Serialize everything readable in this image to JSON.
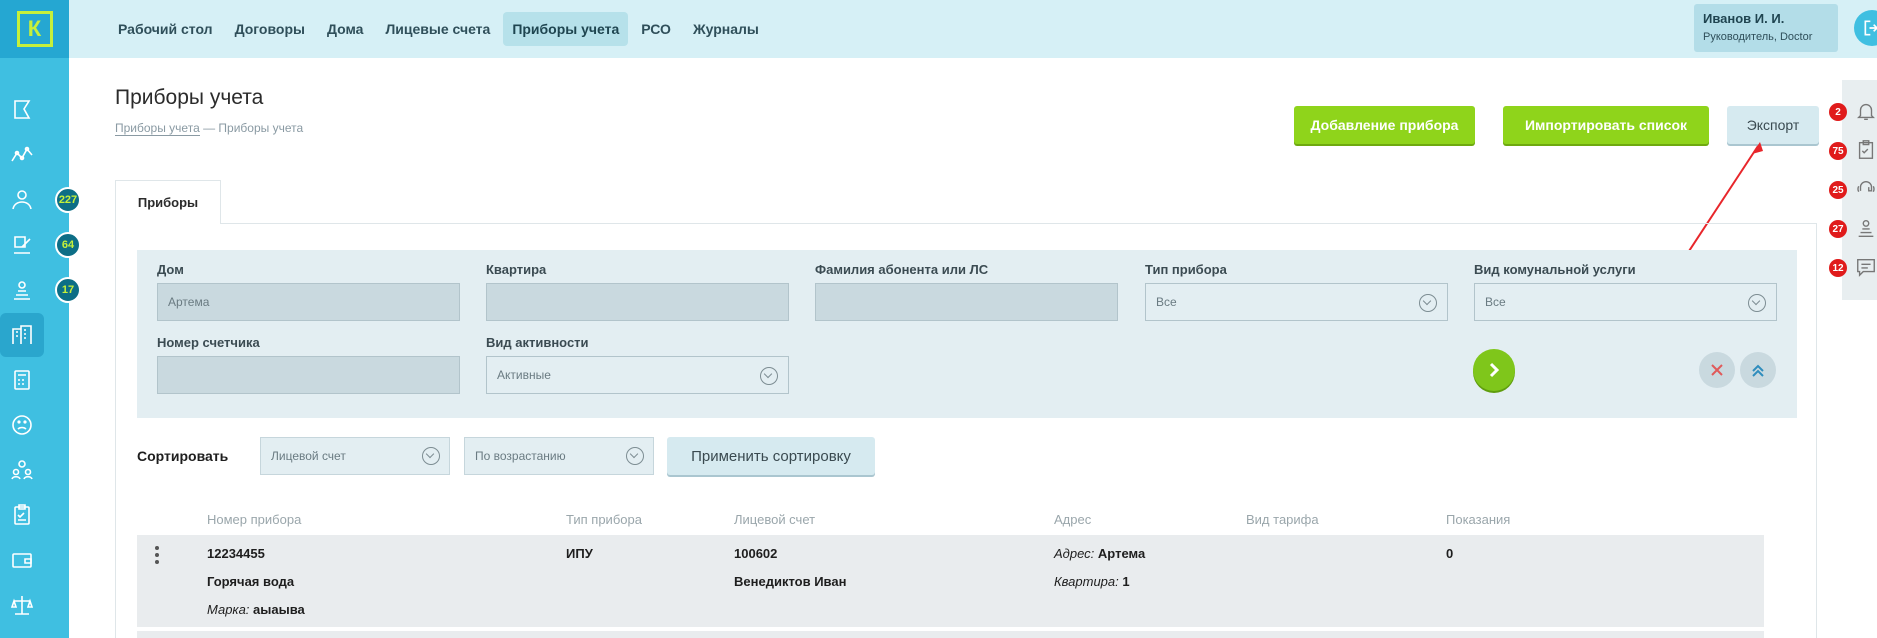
{
  "app": {
    "logo_letter": "К",
    "accent": "#3fbfe1",
    "brand_green": "#8fd41b"
  },
  "nav": {
    "items": [
      {
        "label": "Рабочий стол"
      },
      {
        "label": "Договоры"
      },
      {
        "label": "Дома"
      },
      {
        "label": "Лицевые счета"
      },
      {
        "label": "Приборы учета",
        "active": true
      },
      {
        "label": "РСО"
      },
      {
        "label": "Журналы"
      }
    ]
  },
  "user": {
    "name": "Иванов И. И.",
    "role": "Руководитель, Doctor"
  },
  "sidebar": {
    "badges": {
      "residents": "227",
      "requests": "64",
      "operators": "17"
    }
  },
  "rightpanel": {
    "notifications": "2",
    "tasks": "75",
    "calls": "25",
    "operator": "27",
    "messages": "12"
  },
  "page": {
    "title": "Приборы учета",
    "breadcrumb_link": "Приборы учета",
    "breadcrumb_current": "— Приборы учета"
  },
  "actions": {
    "add": "Добавление прибора",
    "import": "Импортировать список",
    "export": "Экспорт"
  },
  "tabs": {
    "devices": "Приборы"
  },
  "filter": {
    "house_label": "Дом",
    "house_value": "Артема",
    "apartment_label": "Квартира",
    "apartment_value": "",
    "subscriber_label": "Фамилия абонента или ЛС",
    "subscriber_value": "",
    "device_type_label": "Тип прибора",
    "device_type_value": "Все",
    "service_label": "Вид комунальной услуги",
    "service_value": "Все",
    "meter_label": "Номер счетчика",
    "meter_value": "",
    "activity_label": "Вид активности",
    "activity_value": "Активные"
  },
  "sort": {
    "label": "Сортировать",
    "field": "Лицевой счет",
    "order": "По возрастанию",
    "apply": "Применить сортировку"
  },
  "table": {
    "headers": [
      "Номер прибора",
      "Тип прибора",
      "Лицевой счет",
      "Адрес",
      "Вид тарифа",
      "Показания"
    ],
    "rows": [
      {
        "number": "12234455",
        "service": "Горячая вода",
        "brand_label": "Марка:",
        "brand": "аыаыва",
        "type": "ИПУ",
        "account": "100602",
        "owner": "Венедиктов Иван",
        "address_label": "Адрес:",
        "address": "Артема",
        "apartment_label": "Квартира:",
        "apartment": "1",
        "tariff": "",
        "reading": "0"
      }
    ]
  }
}
